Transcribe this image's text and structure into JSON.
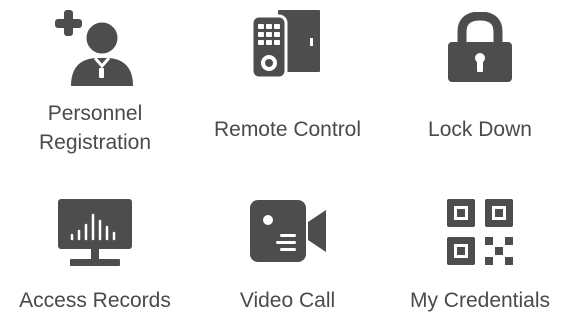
{
  "colors": {
    "icon": "#4d4d4d",
    "label": "#4a4a4a",
    "background": "#ffffff"
  },
  "menu": {
    "items": [
      {
        "icon": "add-person-icon",
        "label_lines": [
          "Personnel",
          "Registration"
        ]
      },
      {
        "icon": "remote-door-icon",
        "label": "Remote Control"
      },
      {
        "icon": "padlock-icon",
        "label": "Lock Down"
      },
      {
        "icon": "monitor-chart-icon",
        "label": "Access Records"
      },
      {
        "icon": "video-camera-icon",
        "label": "Video Call"
      },
      {
        "icon": "qr-code-icon",
        "label": "My Credentials"
      }
    ]
  }
}
